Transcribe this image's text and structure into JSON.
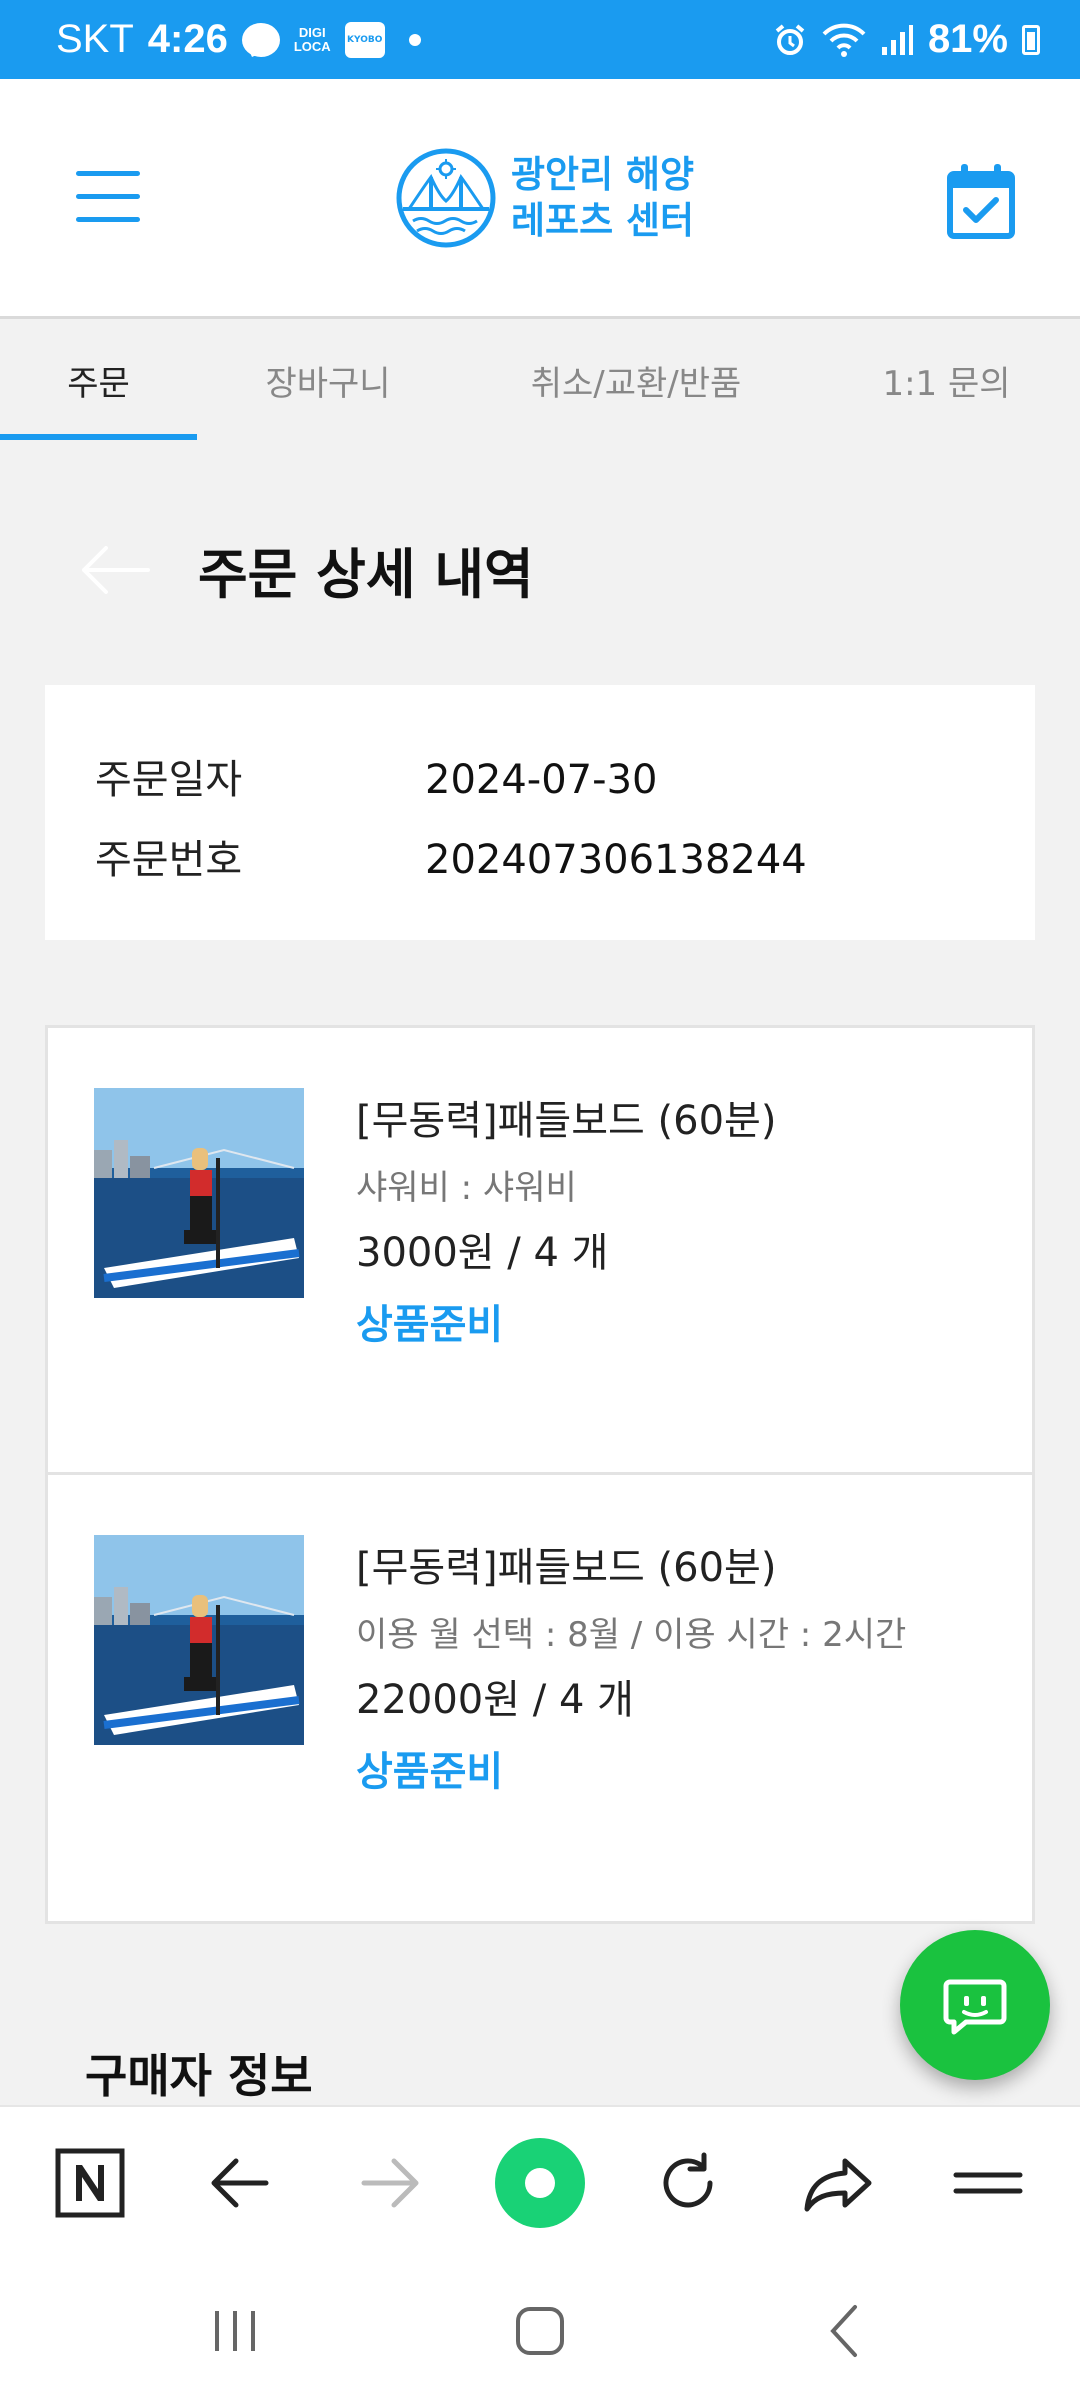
{
  "status_bar": {
    "carrier": "SKT",
    "time": "4:26",
    "digi_line1": "DIGI",
    "digi_line2": "LOCA",
    "kyobo": "KYOBO",
    "battery": "81%"
  },
  "header": {
    "logo_line1": "광안리 해양",
    "logo_line2": "레포츠 센터",
    "menu_icon": "hamburger-icon",
    "calendar_icon": "calendar-check-icon"
  },
  "tabs": [
    {
      "label": "주문",
      "active": true
    },
    {
      "label": "장바구니",
      "active": false
    },
    {
      "label": "취소/교환/반품",
      "active": false
    },
    {
      "label": "1:1 문의",
      "active": false
    }
  ],
  "page": {
    "title": "주문 상세 내역"
  },
  "order": {
    "date_label": "주문일자",
    "date_value": "2024-07-30",
    "number_label": "주문번호",
    "number_value": "202407306138244"
  },
  "items": [
    {
      "name": "[무동력]패들보드 (60분)",
      "option": "샤워비 : 샤워비",
      "price": "3000원 / 4 개",
      "status": "상품준비"
    },
    {
      "name": "[무동력]패들보드 (60분)",
      "option": "이용 월 선택 : 8월 / 이용 시간 : 2시간",
      "price": "22000원 / 4 개",
      "status": "상품준비"
    }
  ],
  "buyer": {
    "heading": "구매자 정보"
  },
  "colors": {
    "accent": "#1a9bf0",
    "chat_green": "#1ac23f",
    "browser_green": "#19d276"
  }
}
